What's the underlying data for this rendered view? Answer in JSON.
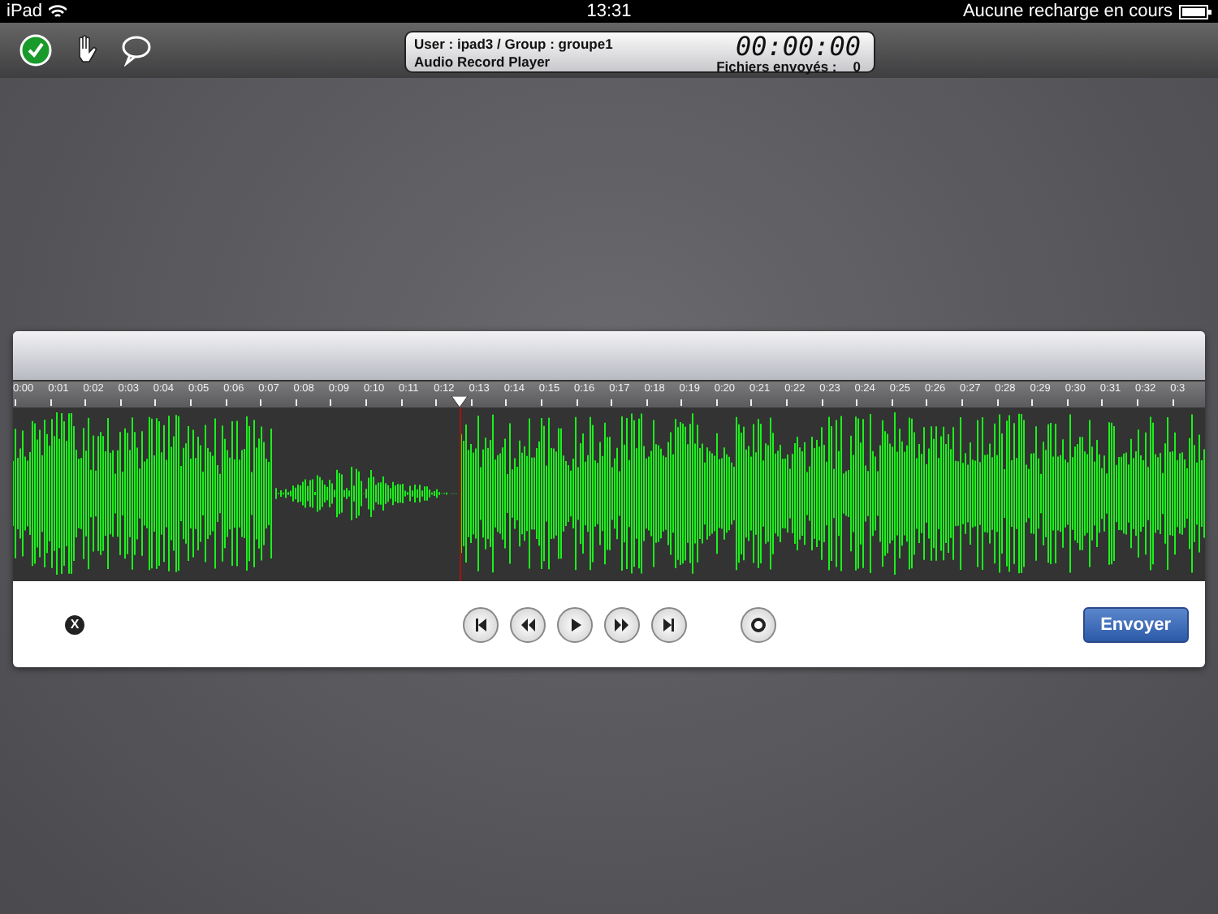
{
  "status_bar": {
    "device": "iPad",
    "time": "13:31",
    "battery_text": "Aucune recharge en cours"
  },
  "toolbar": {
    "user_line": "User : ipad3 / Group : groupe1",
    "app_name": "Audio Record Player",
    "timer": "00:00:00",
    "sent_label": "Fichiers envoyés :",
    "sent_count": "0"
  },
  "timeline": {
    "labels": [
      "0:00",
      "0:01",
      "0:02",
      "0:03",
      "0:04",
      "0:05",
      "0:06",
      "0:07",
      "0:08",
      "0:09",
      "0:10",
      "0:11",
      "0:12",
      "0:13",
      "0:14",
      "0:15",
      "0:16",
      "0:17",
      "0:18",
      "0:19",
      "0:20",
      "0:21",
      "0:22",
      "0:23",
      "0:24",
      "0:25",
      "0:26",
      "0:27",
      "0:28",
      "0:29",
      "0:30",
      "0:31",
      "0:32",
      "0:3"
    ],
    "playhead": {
      "level": 0.375
    }
  },
  "controls": {
    "close": "X",
    "send_button": "Envoyer"
  }
}
